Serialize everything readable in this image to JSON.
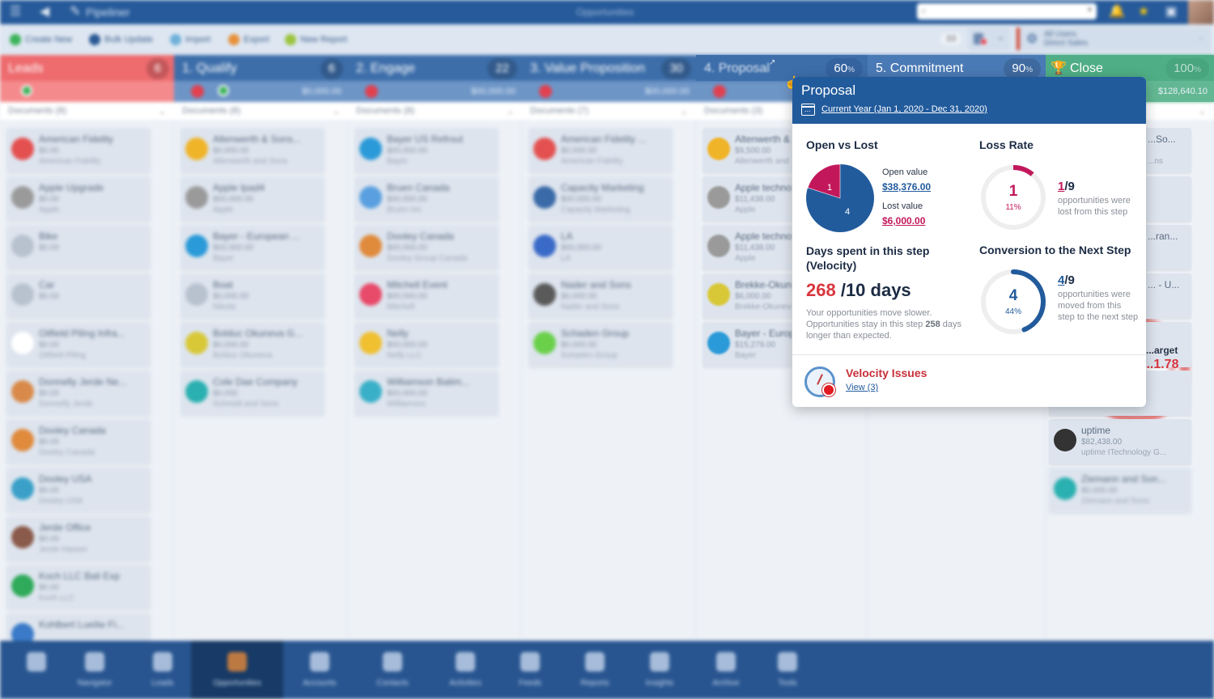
{
  "app": {
    "name": "Pipeliner",
    "title": "Opportunities",
    "search_placeholder": ""
  },
  "toolbar": {
    "buttons": [
      {
        "label": "Create New",
        "icon": "plus-circle-icon",
        "color": "#3bb35a"
      },
      {
        "label": "Bulk Update",
        "icon": "bulk-update-icon",
        "color": "#2b5a94"
      },
      {
        "label": "Import",
        "icon": "import-icon",
        "color": "#6fb0d9"
      },
      {
        "label": "Export",
        "icon": "export-icon",
        "color": "#e8903a"
      },
      {
        "label": "New Report",
        "icon": "report-icon",
        "color": "#9bc53d"
      }
    ],
    "record_count": "33",
    "users_line1": "All Users",
    "users_line2": "Direct Sales"
  },
  "columns": [
    {
      "name": "Leads",
      "pct": "6",
      "amount": "",
      "docs": "Documents (8)",
      "color": "#ee6b6e",
      "cards": [
        {
          "title": "American Fidelity",
          "amount": "$0.00",
          "sub": "American Fidelity",
          "logo": "#e45050"
        },
        {
          "title": "Apple Upgrade",
          "amount": "$0.00",
          "sub": "Apple",
          "logo": "#9a9a9a"
        },
        {
          "title": "Bike",
          "amount": "$0.00",
          "sub": "",
          "logo": "#b8c2cf"
        },
        {
          "title": "Car",
          "amount": "$0.00",
          "sub": "",
          "logo": "#b8c2cf"
        },
        {
          "title": "Oilfield Piling Infra...",
          "amount": "$0.00",
          "sub": "Oilfield Piling",
          "logo": "#ffffff"
        },
        {
          "title": "Donnelly Jerde Ne...",
          "amount": "$0.00",
          "sub": "Donnelly Jerde",
          "logo": "#d98a4a"
        },
        {
          "title": "Dooley Canada",
          "amount": "$0.00",
          "sub": "Dooley Canada",
          "logo": "#e08a3c"
        },
        {
          "title": "Dooley USA",
          "amount": "$0.00",
          "sub": "Dooley USA",
          "logo": "#3aa0c8"
        },
        {
          "title": "Jerde Office",
          "amount": "$0.00",
          "sub": "Jerde Hauser",
          "logo": "#8a5a4a"
        },
        {
          "title": "Koch LLC Bali Exp",
          "amount": "$0.00",
          "sub": "Koch LLC",
          "logo": "#2eaa5a"
        },
        {
          "title": "Kohlbert Lueilw Fi...",
          "amount": "",
          "sub": "",
          "logo": "#3a7ac8"
        }
      ]
    },
    {
      "name": "1. Qualify",
      "pct": "6",
      "amount": "$0,000.00",
      "docs": "Documents (8)",
      "color": "#3d6eaa",
      "cards": [
        {
          "title": "Altenwerth & Sons...",
          "amount": "$0,000.00",
          "sub": "Altenwerth and Sons",
          "logo": "#f0b428"
        },
        {
          "title": "Apple Ipad4",
          "amount": "$00,000.00",
          "sub": "Apple",
          "logo": "#9a9a9a"
        },
        {
          "title": "Bayer - European ...",
          "amount": "$00,000.00",
          "sub": "Bayer",
          "logo": "#2a9ad8"
        },
        {
          "title": "Boat",
          "amount": "$0,000.00",
          "sub": "Nikola",
          "logo": "#b8c2cf"
        },
        {
          "title": "Bolduc Okuneva G...",
          "amount": "$0,000.00",
          "sub": "Bolduc Okuneva",
          "logo": "#d8c838"
        },
        {
          "title": "Cole Dae Company",
          "amount": "$0,000",
          "sub": "Schmidt and Sons",
          "logo": "#2ab0b0"
        }
      ]
    },
    {
      "name": "2. Engage",
      "pct": "22",
      "amount": "$00,000.00",
      "docs": "Documents (8)",
      "color": "#3d6eaa",
      "cards": [
        {
          "title": "Bayer US Refrout",
          "amount": "$00,000.00",
          "sub": "Bayer",
          "logo": "#2a9ad8"
        },
        {
          "title": "Bruen Canada",
          "amount": "$00,000.00",
          "sub": "Bruen Inc",
          "logo": "#5aa0e0"
        },
        {
          "title": "Dooley Canada",
          "amount": "$00,000.00",
          "sub": "Dooley Group Canada",
          "logo": "#e08a3c"
        },
        {
          "title": "Mitchell Event",
          "amount": "$00,000.00",
          "sub": "Mitchell",
          "logo": "#e84a6a"
        },
        {
          "title": "Nelly",
          "amount": "$00,000.00",
          "sub": "Nelly LLC",
          "logo": "#f0c030"
        },
        {
          "title": "Williamson Batim...",
          "amount": "$00,000.00",
          "sub": "Williamson",
          "logo": "#3ab0c8"
        }
      ]
    },
    {
      "name": "3. Value Proposition",
      "pct": "30",
      "amount": "$00,000.00",
      "docs": "Documents (7)",
      "color": "#3d6eaa",
      "cards": [
        {
          "title": "American Fidelity ...",
          "amount": "$0,000.00",
          "sub": "American Fidelity",
          "logo": "#e45050"
        },
        {
          "title": "Capacity Marketing",
          "amount": "$00,000.00",
          "sub": "Capacity Marketing",
          "logo": "#3a6aa8"
        },
        {
          "title": "LA",
          "amount": "$00,000.00",
          "sub": "LA",
          "logo": "#3a6ac8"
        },
        {
          "title": "Nader and Sons",
          "amount": "$0,000.00",
          "sub": "Nader and Sons",
          "logo": "#5a5a5a"
        },
        {
          "title": "Schaden Group",
          "amount": "$0,000.00",
          "sub": "Schaden Group",
          "logo": "#6ad04a"
        }
      ]
    },
    {
      "name": "4. Proposal",
      "pct": "60",
      "amount": "",
      "docs": "Documents (3)",
      "color": "#3d6eaa",
      "cards": [
        {
          "title": "Altenwerth & Sons",
          "amount": "$9,500.00",
          "sub": "Altenwerth and Sons",
          "logo": "#f0b428"
        },
        {
          "title": "Apple technology",
          "amount": "$11,438.00",
          "sub": "Apple",
          "logo": "#9a9a9a"
        },
        {
          "title": "Apple technology",
          "amount": "$11,438.00",
          "sub": "Apple",
          "logo": "#9a9a9a"
        },
        {
          "title": "Brekke-Okuneva",
          "amount": "$6,000.00",
          "sub": "Brekke-Okuneva",
          "logo": "#d8c838"
        },
        {
          "title": "Bayer - European",
          "amount": "$15,279.00",
          "sub": "Bayer",
          "logo": "#2a9ad8"
        }
      ]
    },
    {
      "name": "5. Commitment",
      "pct": "90",
      "amount": "",
      "docs": "",
      "color": "#4a7ab5",
      "cards": []
    },
    {
      "name": "Close",
      "pct": "100",
      "amount": "$128,640.10",
      "docs": "",
      "color": "#4fae86",
      "cards": [
        {
          "title": "...So...",
          "amount": "",
          "sub": "...ns",
          "logo": "#cccccc"
        },
        {
          "title": "",
          "amount": "",
          "sub": "",
          "logo": "#cccccc"
        },
        {
          "title": "...ran...",
          "amount": "",
          "sub": "",
          "logo": "#cccccc"
        },
        {
          "title": "... - U...",
          "amount": "",
          "sub": "",
          "logo": "#cccccc"
        },
        {
          "title": "",
          "amount": "",
          "sub": "",
          "logo": "#cccccc"
        },
        {
          "title": "",
          "amount": "",
          "sub": "",
          "logo": "#cccccc"
        },
        {
          "title": "uptime",
          "amount": "$82,438.00",
          "sub": "uptime ITechnology G...",
          "logo": "#333333"
        },
        {
          "title": "Ziemann and Son...",
          "amount": "$0,000.00",
          "sub": "Ziemann and Sons",
          "logo": "#2ab0b0"
        }
      ]
    }
  ],
  "target_widget": {
    "label": "...arget",
    "value": "...1.78"
  },
  "popup": {
    "title": "Proposal",
    "date_range": "Current Year (Jan 1, 2020 - Dec 31, 2020)",
    "open_vs_lost": {
      "title": "Open vs Lost",
      "open_count": "4",
      "lost_count": "1",
      "open_label": "Open value",
      "open_value": "$38,376.00",
      "lost_label": "Lost value",
      "lost_value": "$6,000.00",
      "open_color": "#225b9c",
      "lost_color": "#c2185b"
    },
    "loss_rate": {
      "title": "Loss Rate",
      "count": "1",
      "percent": "11%",
      "fraction": 0.11,
      "num": "1",
      "den": "/9",
      "desc": "opportunities were lost from this step",
      "color": "#c2185b"
    },
    "velocity": {
      "title": "Days spent in this step (Velocity)",
      "actual": "268",
      "expected": " /10 days",
      "desc_1": "Your opportunities move slower. Opportunities stay in this step ",
      "desc_days": "258",
      "desc_2": " days longer than expected."
    },
    "conversion": {
      "title": "Conversion to the Next Step",
      "count": "4",
      "percent": "44%",
      "fraction": 0.44,
      "num": "4",
      "den": "/9",
      "desc": "opportunities were moved from this step to the next step",
      "color": "#225b9c"
    },
    "velocity_issues": {
      "title": "Velocity Issues",
      "link": "View (3)"
    }
  },
  "bottom_nav": [
    {
      "label": "",
      "icon": "pin-icon"
    },
    {
      "label": "Navigator",
      "icon": "navigator-icon"
    },
    {
      "label": "Leads",
      "icon": "leads-icon"
    },
    {
      "label": "Opportunities",
      "icon": "opportunities-icon",
      "active": true
    },
    {
      "label": "Accounts",
      "icon": "accounts-icon"
    },
    {
      "label": "Contacts",
      "icon": "contacts-icon"
    },
    {
      "label": "Activities",
      "icon": "activities-icon"
    },
    {
      "label": "Feeds",
      "icon": "feeds-icon"
    },
    {
      "label": "Reports",
      "icon": "reports-icon"
    },
    {
      "label": "Insights",
      "icon": "insights-icon"
    },
    {
      "label": "Archive",
      "icon": "archive-icon"
    },
    {
      "label": "Tools",
      "icon": "tools-icon"
    }
  ]
}
